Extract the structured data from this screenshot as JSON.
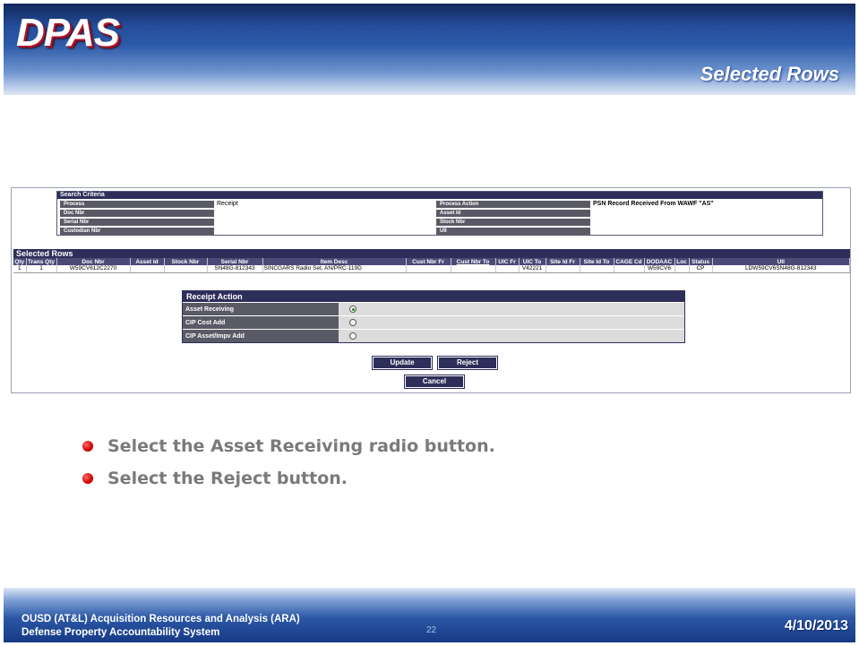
{
  "header": {
    "logo": "DPAS",
    "slide_title": "Selected Rows"
  },
  "search_criteria": {
    "title": "Search Criteria",
    "rows": [
      {
        "left_label": "Process",
        "left_value": "Receipt",
        "right_label": "Process Action",
        "right_value": "PSN Record Received From WAWF \"AS\""
      },
      {
        "left_label": "Doc Nbr",
        "left_value": "",
        "right_label": "Asset Id",
        "right_value": ""
      },
      {
        "left_label": "Serial Nbr",
        "left_value": "",
        "right_label": "Stock Nbr",
        "right_value": ""
      },
      {
        "left_label": "Custodian Nbr",
        "left_value": "",
        "right_label": "UII",
        "right_value": ""
      }
    ]
  },
  "selected_rows": {
    "title": "Selected Rows",
    "columns": [
      "Qty",
      "Trans Qty",
      "Doc Nbr",
      "Asset Id",
      "Stock Nbr",
      "Serial Nbr",
      "Item Desc",
      "Cust Nbr Fr",
      "Cust Nbr To",
      "UIC Fr",
      "UIC To",
      "Site Id Fr",
      "Site Id To",
      "CAGE Cd",
      "DODAAC",
      "Loc",
      "Status",
      "UII"
    ],
    "rows": [
      [
        "1",
        "1",
        "W59CV612C2270",
        "",
        "",
        "SN48G-812343",
        "SINCGARS Radio Set, AN/PRC-119D",
        "",
        "",
        "",
        "V42221",
        "",
        "",
        "",
        "W59CV6",
        "",
        "CP",
        "LDW59CV6SN48G-812343"
      ]
    ]
  },
  "receipt_action": {
    "title": "Receipt Action",
    "options": [
      {
        "label": "Asset Receiving",
        "selected": true
      },
      {
        "label": "CIP Cost Add",
        "selected": false
      },
      {
        "label": "CIP Asset/Impv Add",
        "selected": false
      }
    ]
  },
  "buttons": {
    "update": "Update",
    "reject": "Reject",
    "cancel": "Cancel"
  },
  "bullets": [
    "Select the Asset Receiving radio button.",
    "Select the Reject button."
  ],
  "footer": {
    "org_line1": "OUSD (AT&L) Acquisition Resources and Analysis (ARA)",
    "org_line2": "Defense Property Accountability System",
    "page_number": "22",
    "date": "4/10/2013"
  },
  "colors": {
    "header_blue": "#1c3f8e",
    "table_header": "#2e2e5a",
    "label_gray": "#5a5a66",
    "bullet_red": "#d40000"
  }
}
